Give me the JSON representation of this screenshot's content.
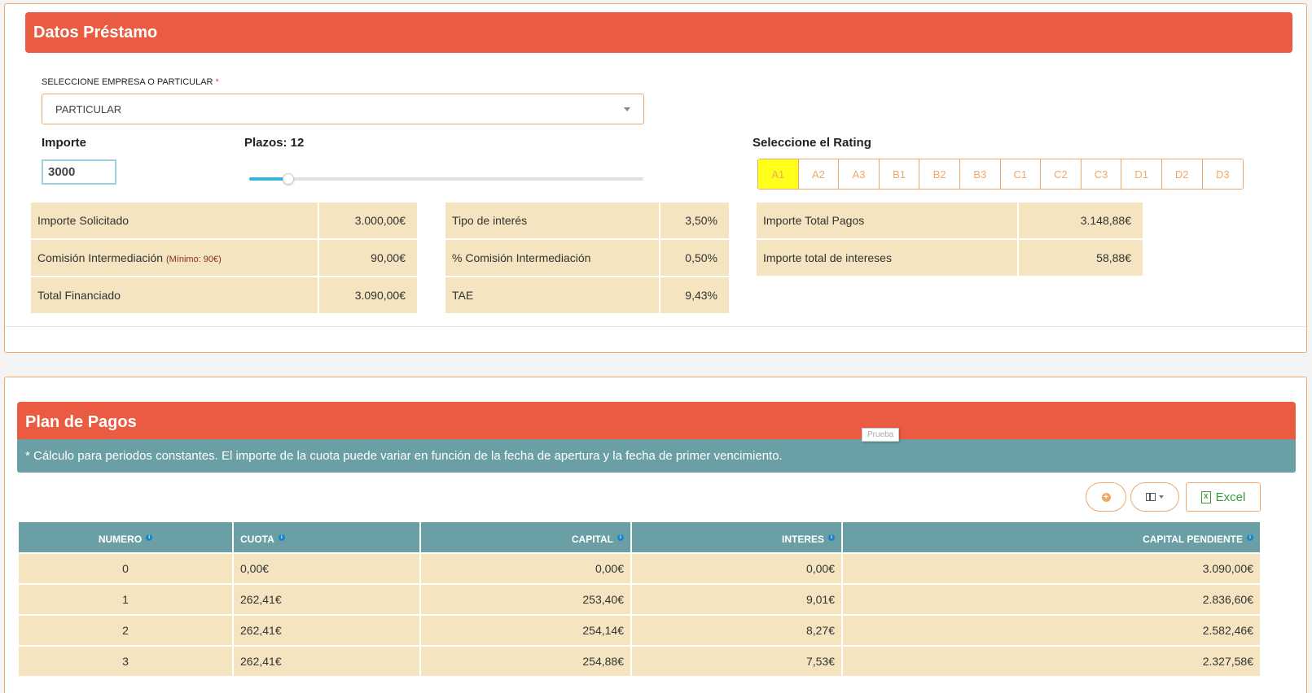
{
  "loan": {
    "title": "Datos Préstamo",
    "client_type_label": "SELECCIONE EMPRESA O PARTICULAR",
    "required_mark": "*",
    "client_type_value": "PARTICULAR",
    "importe_label": "Importe",
    "importe_value": "3000",
    "plazos_label": "Plazos: 12",
    "plazos_slider_fraction": 0.1,
    "rating_label": "Seleccione el Rating",
    "ratings": [
      "A1",
      "A2",
      "A3",
      "B1",
      "B2",
      "B3",
      "C1",
      "C2",
      "C3",
      "D1",
      "D2",
      "D3"
    ],
    "rating_selected": "A1",
    "summary1": [
      {
        "label": "Importe Solicitado",
        "note": "",
        "value": "3.000,00€"
      },
      {
        "label": "Comisión Intermediación",
        "note": "(Mínimo: 90€)",
        "value": "90,00€"
      },
      {
        "label": "Total Financiado",
        "note": "",
        "value": "3.090,00€"
      }
    ],
    "summary2": [
      {
        "label": "Tipo de interés",
        "value": "3,50%"
      },
      {
        "label": "% Comisión Intermediación",
        "value": "0,50%"
      },
      {
        "label": "TAE",
        "value": "9,43%"
      }
    ],
    "summary3": [
      {
        "label": "Importe Total Pagos",
        "value": "3.148,88€"
      },
      {
        "label": "Importe total de intereses",
        "value": "58,88€"
      }
    ]
  },
  "plan": {
    "title": "Plan de Pagos",
    "note": "* Cálculo para periodos constantes. El importe de la cuota puede variar en función de la fecha de apertura y la fecha de primer vencimiento.",
    "tooltip": "Prueba",
    "excel_label": "Excel",
    "columns": [
      "NUMERO",
      "CUOTA",
      "CAPITAL",
      "INTERES",
      "CAPITAL PENDIENTE"
    ],
    "rows": [
      [
        "0",
        "0,00€",
        "0,00€",
        "0,00€",
        "3.090,00€"
      ],
      [
        "1",
        "262,41€",
        "253,40€",
        "9,01€",
        "2.836,60€"
      ],
      [
        "2",
        "262,41€",
        "254,14€",
        "8,27€",
        "2.582,46€"
      ],
      [
        "3",
        "262,41€",
        "254,88€",
        "7,53€",
        "2.327,58€"
      ]
    ]
  },
  "colors": {
    "banner": "#ea5b42",
    "accent": "#f0a868",
    "table_header": "#6b9fa6",
    "cell_bg": "#f5e4c0",
    "rating_active": "#ffff1a"
  }
}
